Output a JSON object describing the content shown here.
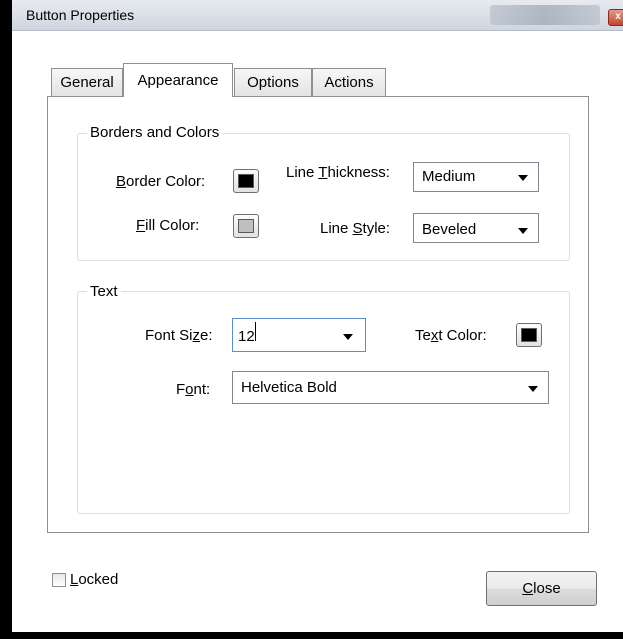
{
  "window": {
    "title": "Button Properties",
    "close_glyph": "x"
  },
  "tabs": [
    {
      "label": "General",
      "active": false
    },
    {
      "label": "Appearance",
      "active": true
    },
    {
      "label": "Options",
      "active": false
    },
    {
      "label": "Actions",
      "active": false
    }
  ],
  "borders_colors": {
    "legend": "Borders and Colors",
    "border_color": {
      "label_pre": "",
      "label_u": "B",
      "label_post": "order Color:",
      "swatch_color": "#000000"
    },
    "fill_color": {
      "label_pre": "",
      "label_u": "F",
      "label_post": "ill Color:",
      "swatch_color": "#c0c0c0"
    },
    "line_thickness": {
      "label_pre": "Line ",
      "label_u": "T",
      "label_post": "hickness:",
      "value": "Medium"
    },
    "line_style": {
      "label_pre": "Line ",
      "label_u": "S",
      "label_post": "tyle:",
      "value": "Beveled"
    }
  },
  "text_group": {
    "legend": "Text",
    "font_size": {
      "label_pre": "Font Si",
      "label_u": "z",
      "label_post": "e:",
      "value": "12"
    },
    "text_color": {
      "label_pre": "Te",
      "label_u": "x",
      "label_post": "t Color:",
      "swatch_color": "#000000"
    },
    "font": {
      "label_pre": "F",
      "label_u": "o",
      "label_post": "nt:",
      "value": "Helvetica Bold"
    }
  },
  "footer": {
    "locked": {
      "label_u": "L",
      "label_post": "ocked",
      "checked": false
    },
    "close_button": {
      "label_u": "C",
      "label_post": "lose"
    }
  },
  "colors": {
    "frame": "#000000",
    "tab_border": "#8e8f8f",
    "group_border": "#d5dfe5"
  },
  "icons": {
    "dropdown": "chevron-down-icon",
    "close": "close-icon"
  }
}
